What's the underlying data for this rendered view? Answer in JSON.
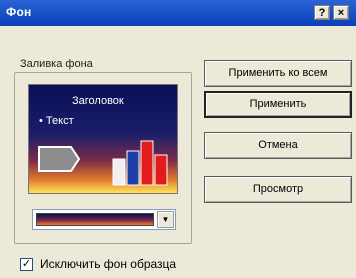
{
  "window": {
    "title": "Фон",
    "help_button": "?",
    "close_button": "×"
  },
  "fill_group": {
    "label": "Заливка фона",
    "preview": {
      "title": "Заголовок",
      "bullet": "• Текст"
    }
  },
  "buttons": {
    "apply_all": "Применить ко всем",
    "apply": "Применить",
    "cancel": "Отмена",
    "preview": "Просмотр"
  },
  "omit_background": {
    "label": "Исключить фон образца",
    "checked": true,
    "mark": "✓"
  },
  "colors": {
    "titlebar": "#0a3fb8",
    "dialog_bg": "#ece9d8"
  }
}
